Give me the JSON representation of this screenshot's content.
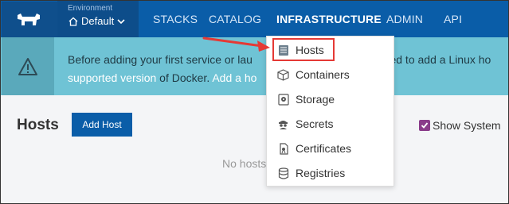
{
  "topbar": {
    "environment_label": "Environment",
    "environment_value": "Default",
    "nav": [
      "STACKS",
      "CATALOG",
      "INFRASTRUCTURE",
      "ADMIN",
      "API"
    ],
    "active": "INFRASTRUCTURE"
  },
  "banner": {
    "line1": "Before adding your first service or lau",
    "line1_tail": "need to add a Linux ho",
    "line2_link": "supported version",
    "line2_text": " of Docker. ",
    "line2_link2": "Add a ho"
  },
  "page": {
    "title": "Hosts",
    "add_button": "Add Host",
    "show_system": "Show System",
    "show_system_checked": true,
    "empty_text": "No hosts"
  },
  "dropdown": {
    "items": [
      {
        "label": "Hosts",
        "icon": "hosts-icon"
      },
      {
        "label": "Containers",
        "icon": "containers-icon"
      },
      {
        "label": "Storage",
        "icon": "storage-icon"
      },
      {
        "label": "Secrets",
        "icon": "secrets-icon"
      },
      {
        "label": "Certificates",
        "icon": "certificates-icon"
      },
      {
        "label": "Registries",
        "icon": "registries-icon"
      }
    ],
    "highlighted": "Hosts"
  },
  "colors": {
    "topbar": "#0a5da8",
    "banner": "#6fc3d5",
    "highlight": "#e53935",
    "checkbox": "#8a3c8a"
  }
}
